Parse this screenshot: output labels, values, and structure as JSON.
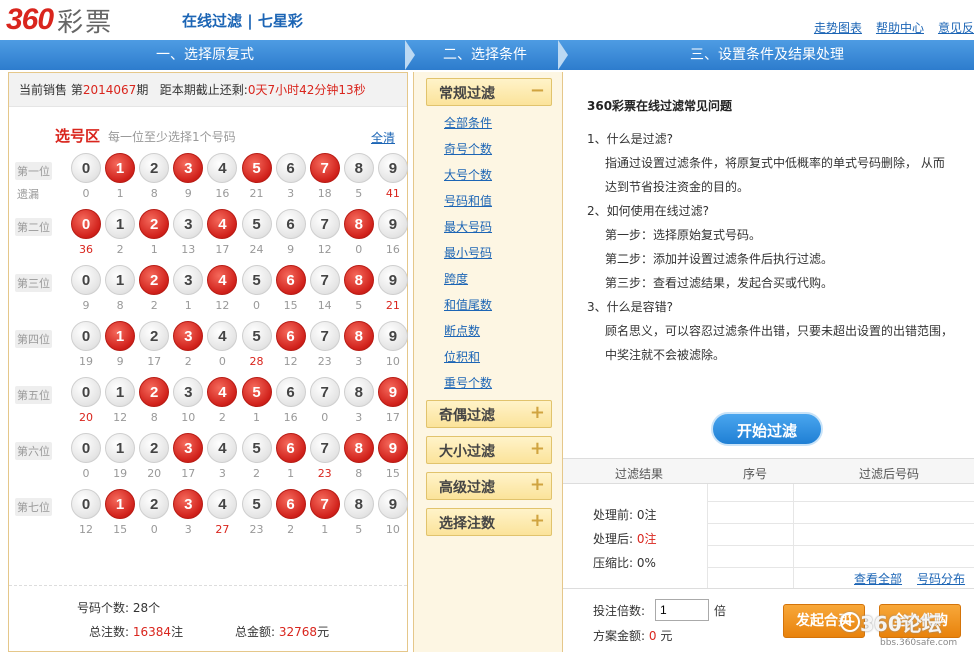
{
  "header": {
    "logo_num": "360",
    "logo_cn": "彩票",
    "subtitle": "在线过滤 | 七星彩",
    "links": [
      "走势图表",
      "帮助中心",
      "意见反"
    ]
  },
  "steps": [
    "一、选择原复式",
    "二、选择条件",
    "三、设置条件及结果处理"
  ],
  "sale": {
    "prefix": "当前销售",
    "issue_pre": "第",
    "issue": "2014067",
    "issue_post": "期",
    "deadline_label": "距本期截止还剩:",
    "deadline": "0天7小时42分钟13秒"
  },
  "picker": {
    "title": "选号区",
    "hint": "每一位至少选择1个号码",
    "clear": "全清",
    "miss_label": "遗漏",
    "digits": [
      "0",
      "1",
      "2",
      "3",
      "4",
      "5",
      "6",
      "7",
      "8",
      "9"
    ],
    "rows": [
      {
        "label": "第一位",
        "selected": [
          1,
          3,
          5,
          7
        ],
        "miss": [
          "0",
          "1",
          "8",
          "9",
          "16",
          "21",
          "3",
          "18",
          "5",
          "41"
        ],
        "hot": [
          9
        ]
      },
      {
        "label": "第二位",
        "selected": [
          0,
          2,
          4,
          8
        ],
        "miss": [
          "36",
          "2",
          "1",
          "13",
          "17",
          "24",
          "9",
          "12",
          "0",
          "16"
        ],
        "hot": [
          0
        ]
      },
      {
        "label": "第三位",
        "selected": [
          2,
          4,
          6,
          8
        ],
        "miss": [
          "9",
          "8",
          "2",
          "1",
          "12",
          "0",
          "15",
          "14",
          "5",
          "21"
        ],
        "hot": [
          9
        ]
      },
      {
        "label": "第四位",
        "selected": [
          1,
          3,
          6,
          8
        ],
        "miss": [
          "19",
          "9",
          "17",
          "2",
          "0",
          "28",
          "12",
          "23",
          "3",
          "10"
        ],
        "hot": [
          5
        ]
      },
      {
        "label": "第五位",
        "selected": [
          2,
          4,
          5,
          9
        ],
        "miss": [
          "20",
          "12",
          "8",
          "10",
          "2",
          "1",
          "16",
          "0",
          "3",
          "17"
        ],
        "hot": [
          0
        ]
      },
      {
        "label": "第六位",
        "selected": [
          3,
          6,
          8,
          9
        ],
        "miss": [
          "0",
          "19",
          "20",
          "17",
          "3",
          "2",
          "1",
          "23",
          "8",
          "15"
        ],
        "hot": [
          7
        ]
      },
      {
        "label": "第七位",
        "selected": [
          1,
          3,
          6,
          7
        ],
        "miss": [
          "12",
          "15",
          "0",
          "3",
          "27",
          "23",
          "2",
          "1",
          "5",
          "10"
        ],
        "hot": [
          4
        ]
      }
    ],
    "count_label": "号码个数:",
    "count": "28个",
    "total_label": "总注数:",
    "total": "16384",
    "total_unit": "注",
    "amount_label": "总金额:",
    "amount": "32768",
    "amount_unit": "元"
  },
  "conditions": {
    "cats": [
      {
        "label": "常规过滤",
        "sign": "−"
      },
      {
        "label": "奇偶过滤",
        "sign": "+"
      },
      {
        "label": "大小过滤",
        "sign": "+"
      },
      {
        "label": "高级过滤",
        "sign": "+"
      },
      {
        "label": "选择注数",
        "sign": "+"
      }
    ],
    "subs": [
      "全部条件",
      "奇号个数",
      "大号个数",
      "号码和值",
      "最大号码",
      "最小号码",
      "跨度",
      "和值尾数",
      "断点数",
      "位积和",
      "重号个数"
    ]
  },
  "faq": {
    "title": "360彩票在线过滤常见问题",
    "q1": "1、什么是过滤?",
    "a1a": "指通过设置过滤条件，将原复式中低概率的单式号码删除， 从而",
    "a1b": "达到节省投注资金的目的。",
    "q2": "2、如何使用在线过滤?",
    "a2a": "第一步：选择原始复式号码。",
    "a2b": "第二步：添加并设置过滤条件后执行过滤。",
    "a2c": "第三步：查看过滤结果，发起合买或代购。",
    "q3": "3、什么是容错?",
    "a3a": "顾名思义，可以容忍过滤条件出错，只要未超出设置的出错范围，",
    "a3b": "中奖注就不会被滤除。"
  },
  "result": {
    "start": "开始过滤",
    "col1": "过滤结果",
    "col2": "序号",
    "col3": "过滤后号码",
    "before_label": "处理前:",
    "before": "0注",
    "after_label": "处理后:",
    "after": "0注",
    "ratio_label": "压缩比:",
    "ratio": "0%",
    "view_all": "查看全部",
    "distribution": "号码分布",
    "mult_label": "投注倍数:",
    "mult_value": "1",
    "mult_unit": "倍",
    "amount_label": "方案金额:",
    "amount": "0",
    "amount_unit": "元",
    "btn_group": "发起合买",
    "btn_buy": "全力代购"
  },
  "watermark": {
    "text": "360论坛",
    "url": "bbs.360safe.com"
  }
}
